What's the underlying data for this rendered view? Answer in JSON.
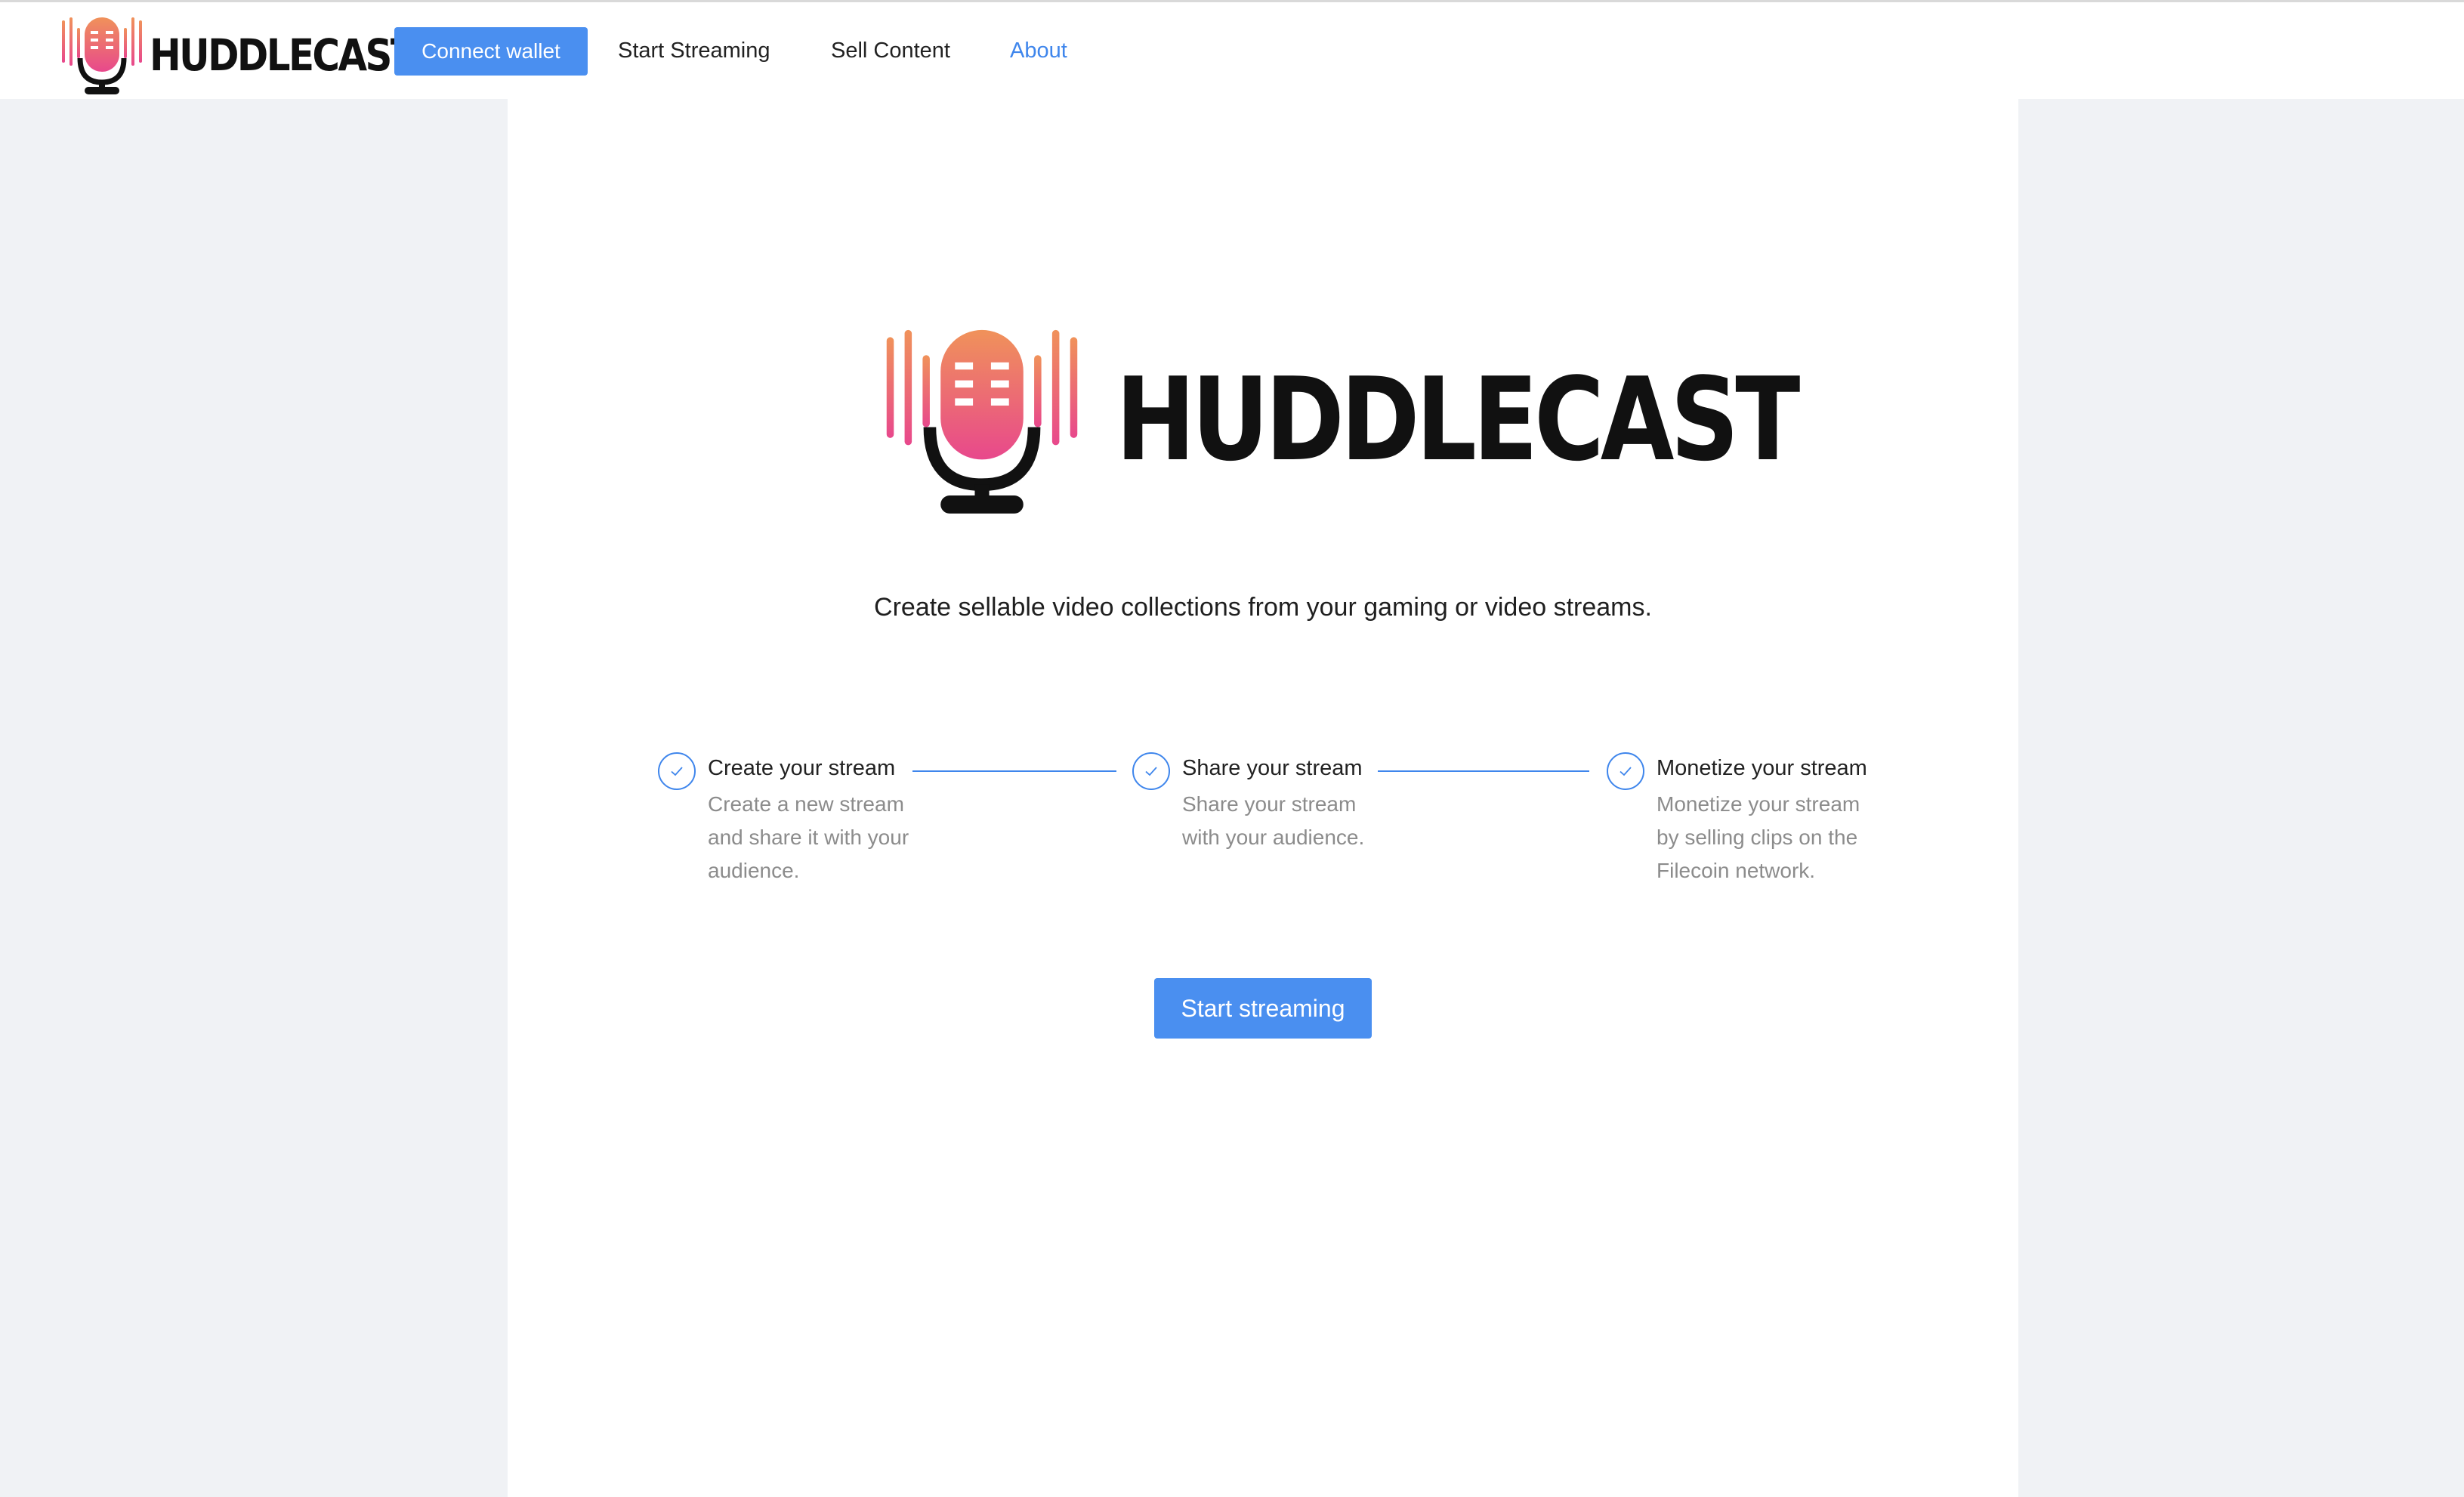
{
  "brand": {
    "name": "HUDDLECAST"
  },
  "nav": {
    "connect_wallet": "Connect wallet",
    "items": [
      {
        "label": "Start Streaming",
        "active": false
      },
      {
        "label": "Sell Content",
        "active": false
      },
      {
        "label": "About",
        "active": true
      }
    ]
  },
  "hero": {
    "logo_text": "HUDDLECAST",
    "tagline": "Create sellable video collections from your gaming or video streams."
  },
  "steps": [
    {
      "title": "Create your stream",
      "description_lines": [
        "Create a new stream",
        "and share it with your",
        "audience."
      ],
      "status": "done"
    },
    {
      "title": "Share your stream",
      "description_lines": [
        "Share your stream",
        "with your audience."
      ],
      "status": "done"
    },
    {
      "title": "Monetize your stream",
      "description_lines": [
        "Monetize your stream",
        "by selling clips on the",
        "Filecoin network."
      ],
      "status": "done"
    }
  ],
  "cta": {
    "label": "Start streaming"
  },
  "icons": {
    "logo": "microphone-soundwave-icon",
    "step": "check-circle-icon"
  },
  "colors": {
    "primary": "#4a8ff0",
    "accent": "#3f86ec",
    "logo_gradient_top": "#f0925a",
    "logo_gradient_bottom": "#e8488c",
    "page_background": "#f0f2f5"
  }
}
